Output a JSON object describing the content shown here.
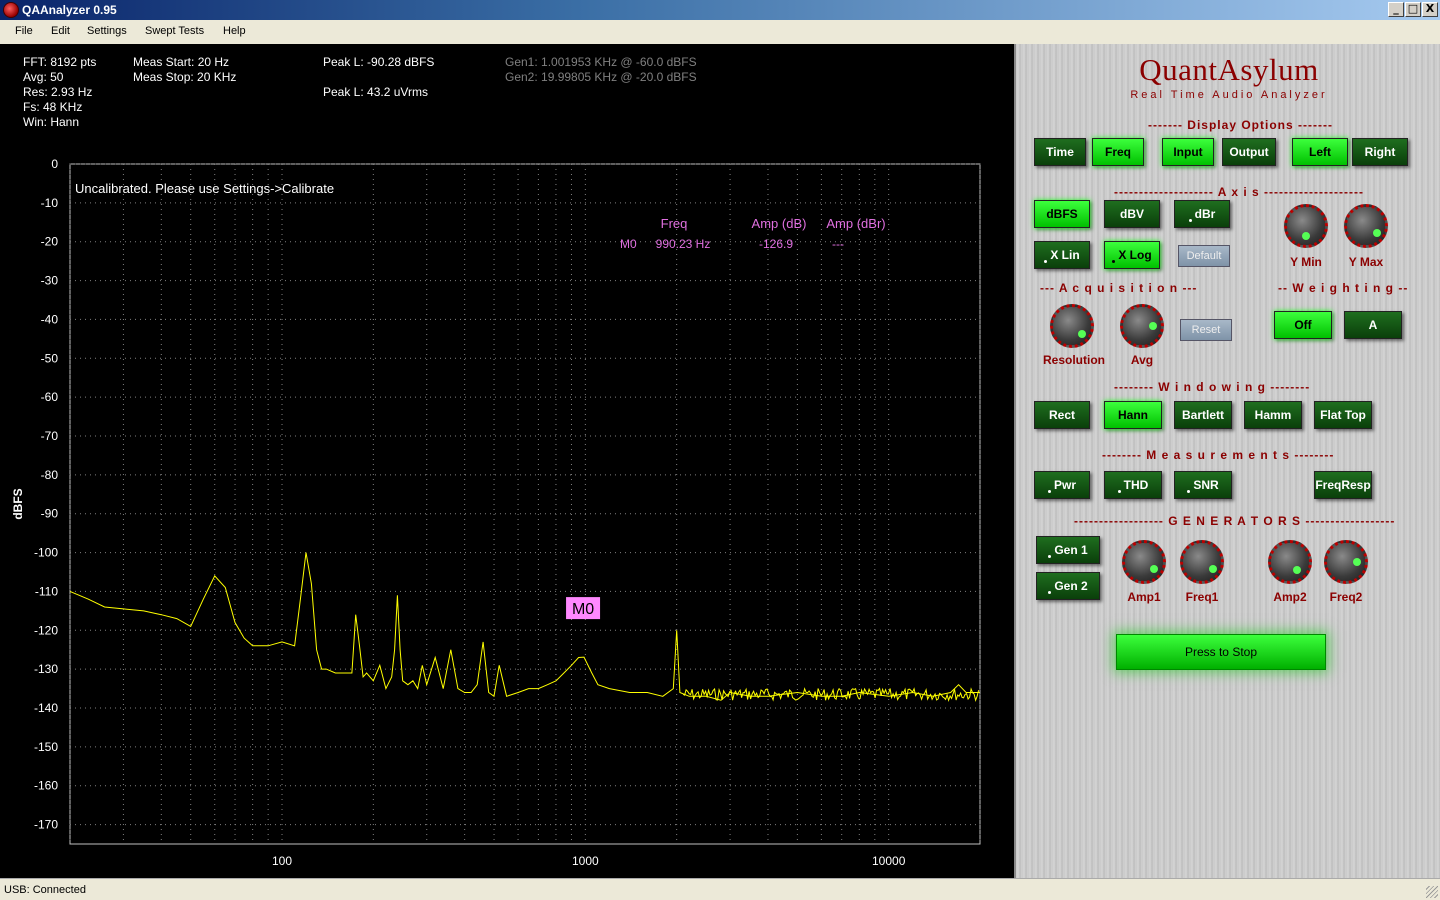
{
  "window": {
    "title": "QAAnalyzer 0.95",
    "minimize": "_",
    "maximize": "□",
    "close": "X"
  },
  "menu": [
    "File",
    "Edit",
    "Settings",
    "Swept Tests",
    "Help"
  ],
  "info": {
    "fft": "FFT: 8192 pts",
    "avg": "Avg: 50",
    "res": "Res: 2.93 Hz",
    "fs": "Fs: 48 KHz",
    "win": "Win: Hann",
    "meas_start": "Meas Start: 20 Hz",
    "meas_stop": "Meas Stop: 20 KHz",
    "peak_dbfs": "Peak L: -90.28 dBFS",
    "peak_vrms": "Peak L: 43.2 uVrms",
    "gen1": "Gen1: 1.001953 KHz @ -60.0 dBFS",
    "gen2": "Gen2: 19.99805 KHz @ -20.0 dBFS"
  },
  "chart_data": {
    "type": "line",
    "ylabel": "dBFS",
    "xlabel": "",
    "x_scale": "log",
    "xlim": [
      20,
      20000
    ],
    "ylim": [
      -175,
      0
    ],
    "y_ticks": [
      0,
      -10,
      -20,
      -30,
      -40,
      -50,
      -60,
      -70,
      -80,
      -90,
      -100,
      -110,
      -120,
      -130,
      -140,
      -150,
      -160,
      -170
    ],
    "x_ticks": [
      100,
      1000,
      10000
    ],
    "x_tick_labels": [
      "100",
      "1000",
      "10000"
    ],
    "grid": true,
    "line_color": "#ffff00",
    "annotation": "Uncalibrated. Please use Settings->Calibrate",
    "marker_table": {
      "headers": [
        "Freq",
        "Amp (dB)",
        "Amp (dBr)"
      ],
      "rows": [
        {
          "name": "M0",
          "freq": "990.23 Hz",
          "amp_db": "-126.9",
          "amp_dbr": "---"
        }
      ]
    },
    "marker": {
      "label": "M0",
      "x": 990.23,
      "y": -126.9
    },
    "series": [
      {
        "x": [
          20,
          23,
          26,
          30,
          35,
          40,
          45,
          50,
          55,
          60,
          65,
          70,
          75,
          80,
          90,
          100,
          110,
          115,
          120,
          125,
          130,
          135,
          140,
          150,
          160,
          170,
          175,
          180,
          185,
          190,
          200,
          210,
          220,
          230,
          235,
          240,
          245,
          250,
          260,
          270,
          280,
          290,
          300,
          320,
          340,
          360,
          380,
          400,
          420,
          440,
          460,
          480,
          500,
          520,
          550,
          600,
          650,
          700,
          750,
          800,
          850,
          900,
          950,
          990,
          1050,
          1100,
          1200,
          1400,
          1600,
          1800,
          1950,
          2000,
          2050,
          2200,
          2500,
          2800,
          3000,
          3500,
          4000,
          5000,
          6000,
          7000,
          8000,
          10000,
          12000,
          14000,
          16000,
          17000,
          18000,
          20000
        ],
        "y": [
          -110,
          -112,
          -114,
          -114.5,
          -115,
          -116,
          -117,
          -119,
          -112,
          -106,
          -109,
          -118,
          -122,
          -124,
          -124,
          -123,
          -124,
          -112,
          -100,
          -108,
          -125,
          -130,
          -130,
          -131,
          -131,
          -131,
          -116,
          -124,
          -132,
          -131,
          -133,
          -129,
          -135,
          -132,
          -125,
          -111,
          -125,
          -133,
          -134,
          -133,
          -135,
          -129,
          -134,
          -127,
          -135,
          -125,
          -135,
          -136,
          -136,
          -134,
          -123,
          -136,
          -137,
          -129,
          -137,
          -136,
          -135,
          -135,
          -134,
          -133,
          -131,
          -129,
          -127,
          -126.9,
          -131,
          -134,
          -135,
          -136,
          -136,
          -137,
          -135,
          -120,
          -136,
          -137,
          -137,
          -138,
          -136,
          -137,
          -137,
          -136,
          -137,
          -137,
          -136,
          -137,
          -136,
          -137,
          -136,
          -134,
          -136,
          -136
        ]
      }
    ]
  },
  "panel": {
    "brand": "QuantAsylum",
    "subtitle": "Real Time Audio Analyzer",
    "sections": {
      "display": "------- Display Options -------",
      "axis": "-------------------- A x i s --------------------",
      "acquisition": "--- A c q u i s i t i o n ---",
      "weighting": "-- W e i g h t i n g --",
      "windowing": "-------- W i n d o w i n g --------",
      "measurements": "-------- M e a s u r e m e n t s --------",
      "generators": "------------------ G E N E R A T O R S ------------------"
    },
    "display_buttons": {
      "time": "Time",
      "freq": "Freq",
      "input": "Input",
      "output": "Output",
      "left": "Left",
      "right": "Right"
    },
    "axis_buttons": {
      "dbfs": "dBFS",
      "dbv": "dBV",
      "dbr": "dBr",
      "xlin": "X Lin",
      "xlog": "X Log",
      "default": "Default"
    },
    "knobs": {
      "ymin": "Y Min",
      "ymax": "Y Max",
      "resolution": "Resolution",
      "avg": "Avg",
      "amp1": "Amp1",
      "freq1": "Freq1",
      "amp2": "Amp2",
      "freq2": "Freq2"
    },
    "reset": "Reset",
    "weighting_buttons": {
      "off": "Off",
      "a": "A"
    },
    "window_buttons": {
      "rect": "Rect",
      "hann": "Hann",
      "bartlett": "Bartlett",
      "hamm": "Hamm",
      "flattop": "Flat Top"
    },
    "measure_buttons": {
      "pwr": "Pwr",
      "thd": "THD",
      "snr": "SNR",
      "freqresp": "FreqResp"
    },
    "gen_buttons": {
      "gen1": "Gen 1",
      "gen2": "Gen 2"
    },
    "stop": "Press to Stop"
  },
  "status": "USB: Connected"
}
